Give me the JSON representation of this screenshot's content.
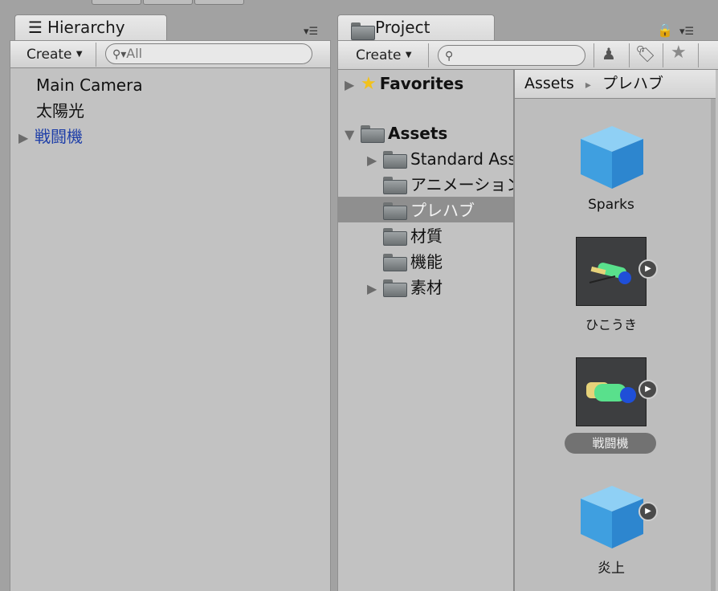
{
  "hierarchy": {
    "tab_label": "Hierarchy",
    "create_label": "Create",
    "search_placeholder": "All",
    "items": [
      {
        "label": "Main Camera"
      },
      {
        "label": "太陽光"
      },
      {
        "label": "戦闘機"
      }
    ]
  },
  "project": {
    "tab_label": "Project",
    "create_label": "Create",
    "favorites_label": "Favorites",
    "assets_label": "Assets",
    "folders": [
      {
        "label": "Standard Assets"
      },
      {
        "label": "アニメーション"
      },
      {
        "label": "プレハブ"
      },
      {
        "label": "材質"
      },
      {
        "label": "機能"
      },
      {
        "label": "素材"
      }
    ],
    "breadcrumb": {
      "root": "Assets",
      "separator": "▸",
      "current": "プレハブ"
    },
    "grid_items": [
      {
        "label": "Sparks"
      },
      {
        "label": "ひこうき"
      },
      {
        "label": "戦闘機"
      },
      {
        "label": "炎上"
      }
    ]
  },
  "colors": {
    "selection": "#8f8f8f",
    "link_blue": "#1f3fa8",
    "cube_blue": "#4aa7e8"
  }
}
